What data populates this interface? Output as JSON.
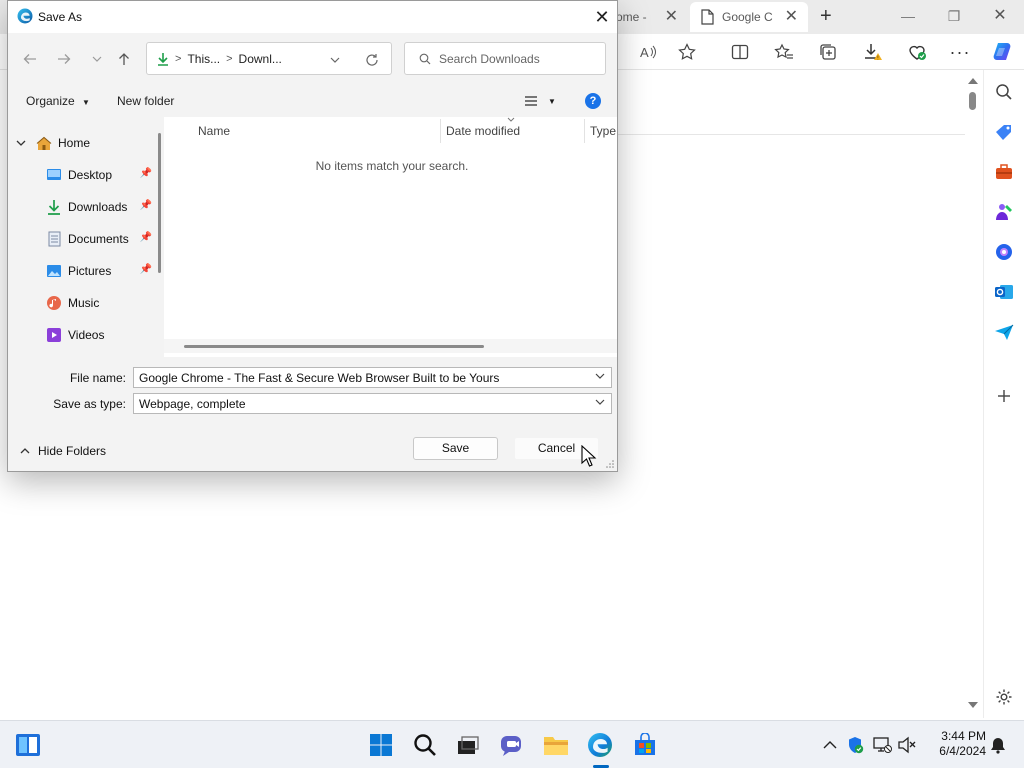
{
  "browser": {
    "tabs": [
      {
        "label": "rome -"
      },
      {
        "label": "Google C"
      }
    ],
    "window_controls": [
      "minimize",
      "restore",
      "close"
    ],
    "toolbar_icons": [
      "read-aloud-icon",
      "favorite-star-icon",
      "split-screen-icon",
      "favorites-icon",
      "collections-icon",
      "downloads-warning-icon",
      "browser-essentials-icon",
      "more-icon",
      "copilot-icon"
    ],
    "sidebar_icons": [
      "search-icon",
      "shopping-tag-icon",
      "tools-briefcase-icon",
      "games-icon",
      "office-icon",
      "outlook-icon",
      "send-icon",
      "add-icon",
      "settings-icon"
    ]
  },
  "dialog": {
    "title": "Save As",
    "address": {
      "segments": [
        "This...",
        "Downl..."
      ]
    },
    "search": {
      "placeholder": "Search Downloads",
      "value": ""
    },
    "cmdbar": {
      "organize": "Organize",
      "new_folder": "New folder"
    },
    "nav_pane": {
      "items": [
        {
          "label": "Home",
          "icon": "home-icon",
          "pinned": false,
          "expanded": true
        },
        {
          "label": "Desktop",
          "icon": "desktop-icon",
          "pinned": true
        },
        {
          "label": "Downloads",
          "icon": "downloads-icon",
          "pinned": true
        },
        {
          "label": "Documents",
          "icon": "documents-icon",
          "pinned": true
        },
        {
          "label": "Pictures",
          "icon": "pictures-icon",
          "pinned": true
        },
        {
          "label": "Music",
          "icon": "music-icon",
          "pinned": false
        },
        {
          "label": "Videos",
          "icon": "videos-icon",
          "pinned": false
        }
      ]
    },
    "file_pane": {
      "columns": [
        "Name",
        "Date modified",
        "Type"
      ],
      "empty_message": "No items match your search."
    },
    "file_name": {
      "label": "File name:",
      "value": "Google Chrome - The Fast & Secure Web Browser Built to be Yours"
    },
    "save_as_type": {
      "label": "Save as type:",
      "value": "Webpage, complete"
    },
    "hide_folders": "Hide Folders",
    "save_label": "Save",
    "cancel_label": "Cancel"
  },
  "taskbar": {
    "icons": [
      "widgets-icon",
      "start-icon",
      "search-icon",
      "task-view-icon",
      "chat-icon",
      "file-explorer-icon",
      "edge-icon",
      "store-icon"
    ],
    "clock": {
      "time": "3:44 PM",
      "date": "6/4/2024"
    }
  },
  "colors": {
    "accent": "#0067c0",
    "edge_blue": "#1a73e8",
    "dialog_bg": "#f3f3f3",
    "download_green": "#1e9e4a"
  }
}
